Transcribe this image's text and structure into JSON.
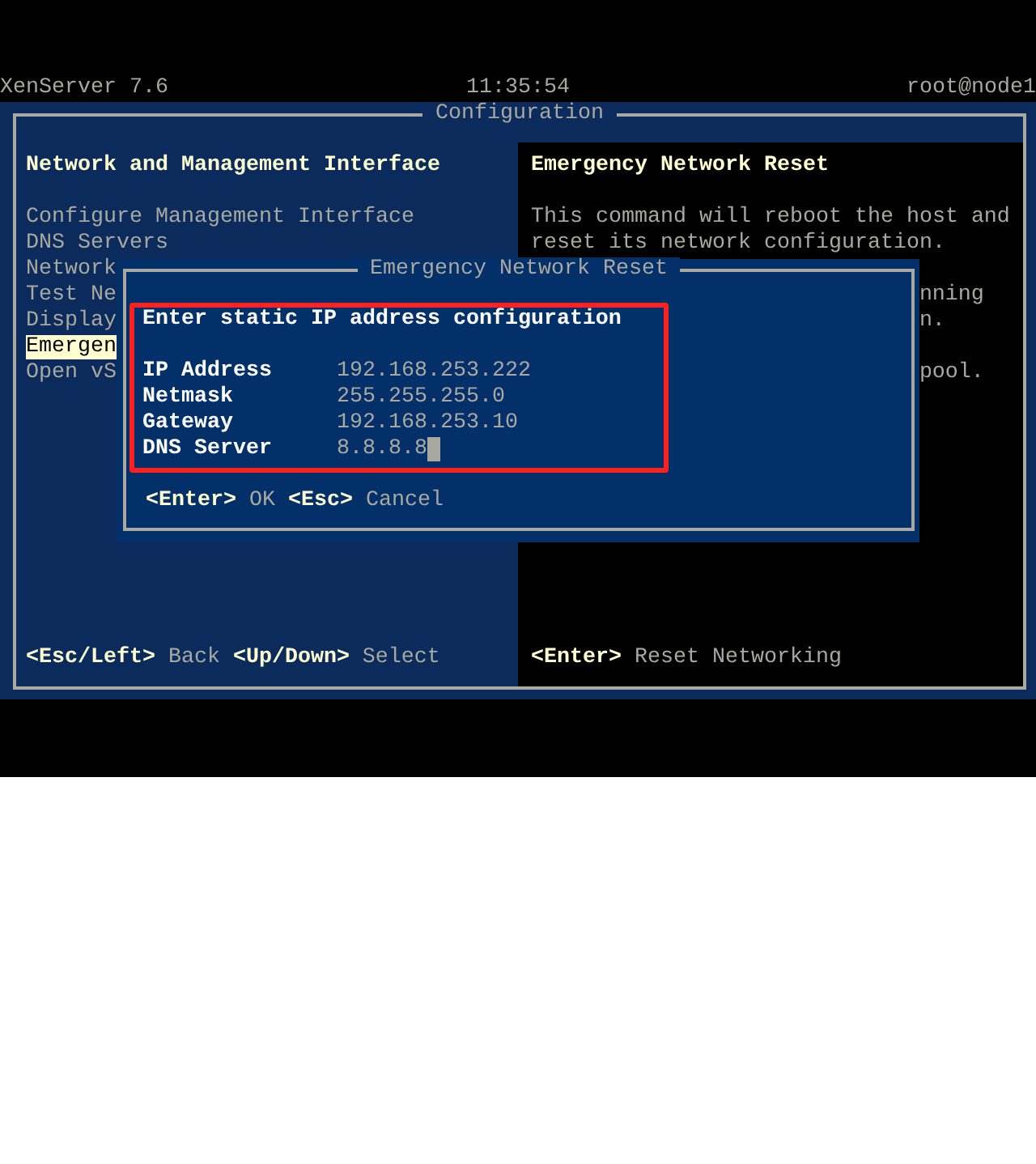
{
  "header": {
    "product": "XenServer 7.6",
    "time": "11:35:54",
    "user": "root@node1"
  },
  "configuration": {
    "title": "Configuration",
    "menu": {
      "heading": "Network and Management Interface",
      "items": [
        {
          "label": "Configure Management Interface",
          "selected": false
        },
        {
          "label": "DNS Servers",
          "selected": false
        },
        {
          "label": "Network",
          "selected": false
        },
        {
          "label": "Test Ne",
          "selected": false
        },
        {
          "label": "Display",
          "selected": false
        },
        {
          "label": "Emergen",
          "selected": true
        },
        {
          "label": "Open vS",
          "selected": false
        }
      ],
      "hints": [
        {
          "key": "<Esc/Left>",
          "action": "Back"
        },
        {
          "key": "<Up/Down>",
          "action": "Select"
        }
      ]
    },
    "detail": {
      "heading": "Emergency Network Reset",
      "paragraphs": [
        {
          "kind": "full",
          "lines": [
            "This command will reboot the host and",
            "reset its network configuration."
          ]
        },
        {
          "kind": "cut",
          "lines": [
            "nning",
            "n."
          ]
        },
        {
          "kind": "cut",
          "lines": [
            "pool."
          ]
        }
      ],
      "hints": [
        {
          "key": "<Enter>",
          "action": "Reset Networking"
        }
      ]
    }
  },
  "dialog": {
    "title": "Emergency Network Reset",
    "heading": "Enter static IP address configuration",
    "fields": [
      {
        "label": "IP Address",
        "value": "192.168.253.222",
        "focused": false
      },
      {
        "label": "Netmask",
        "value": "255.255.255.0",
        "focused": false
      },
      {
        "label": "Gateway",
        "value": "192.168.253.10",
        "focused": false
      },
      {
        "label": "DNS Server",
        "value": "8.8.8.8",
        "focused": true
      }
    ],
    "hints": [
      {
        "key": "<Enter>",
        "action": "OK"
      },
      {
        "key": "<Esc>",
        "action": "Cancel"
      }
    ]
  }
}
